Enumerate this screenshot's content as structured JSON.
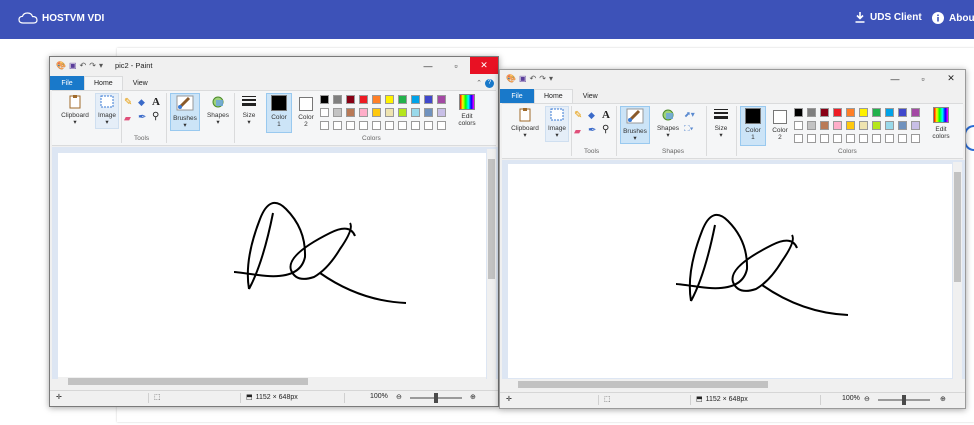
{
  "header": {
    "brand": "HOSTVM VDI",
    "uds_client": "UDS Client",
    "about": "About",
    "bg_color": "#3d52b8"
  },
  "windows": [
    {
      "title": "pic2 - Paint",
      "menu": {
        "file": "File",
        "home": "Home",
        "view": "View"
      },
      "ribbon": {
        "clipboard": "Clipboard",
        "image": "Image",
        "tools": "Tools",
        "brushes": "Brushes",
        "shapes": "Shapes",
        "size": "Size",
        "color1": "Color\n1",
        "color2": "Color\n2",
        "colors_group": "Colors",
        "edit_colors": "Edit\ncolors"
      },
      "status": {
        "dimensions": "1152 × 648px",
        "zoom": "100%"
      },
      "focused": true
    },
    {
      "title": "",
      "menu": {
        "file": "File",
        "home": "Home",
        "view": "View"
      },
      "ribbon": {
        "clipboard": "Clipboard",
        "image": "Image",
        "tools": "Tools",
        "brushes": "Brushes",
        "shapes": "Shapes",
        "shapes_group": "Shapes",
        "size": "Size",
        "color1": "Color\n1",
        "color2": "Color\n2",
        "colors_group": "Colors",
        "edit_colors": "Edit\ncolors"
      },
      "status": {
        "dimensions": "1152 × 648px",
        "zoom": "100%"
      },
      "focused": false
    }
  ],
  "palette_row1": [
    "#000000",
    "#7f7f7f",
    "#880015",
    "#ed1c24",
    "#ff7f27",
    "#fff200",
    "#22b14c",
    "#00a2e8",
    "#3f48cc",
    "#a349a4"
  ],
  "palette_row2": [
    "#ffffff",
    "#c3c3c3",
    "#b97a57",
    "#ffaec9",
    "#ffc90e",
    "#efe4b0",
    "#b5e61d",
    "#99d9ea",
    "#7092be",
    "#c8bfe7"
  ],
  "accent": "#1979ca"
}
